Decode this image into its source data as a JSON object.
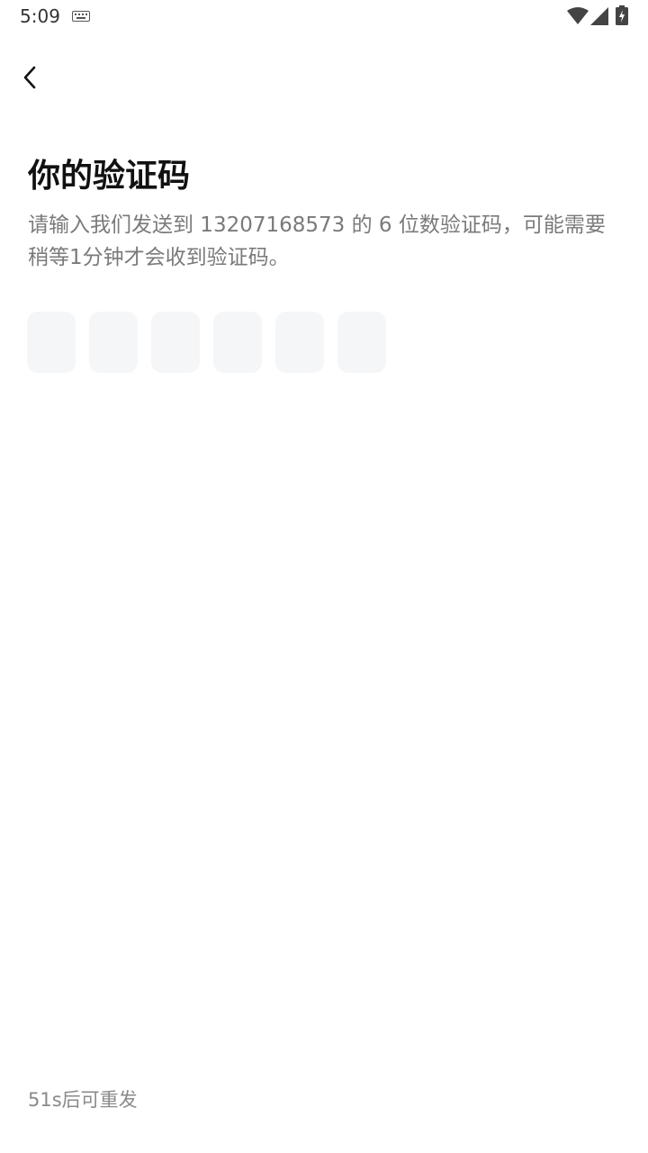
{
  "status_bar": {
    "time": "5:09",
    "icons": [
      "keyboard-icon",
      "wifi-icon",
      "signal-icon",
      "battery-charging-icon"
    ]
  },
  "header": {
    "back_icon": "chevron-left-icon"
  },
  "main": {
    "title": "你的验证码",
    "subtitle": "请输入我们发送到 13207168573 的 6 位数验证码，可能需要稍等1分钟才会收到验证码。",
    "code_boxes": [
      "",
      "",
      "",
      "",
      "",
      ""
    ]
  },
  "footer": {
    "resend_label": "51s后可重发"
  },
  "colors": {
    "background": "#ffffff",
    "code_box_bg": "#f5f6f8",
    "subtitle_text": "#7a7a7a",
    "resend_text": "#8a8a8a"
  }
}
